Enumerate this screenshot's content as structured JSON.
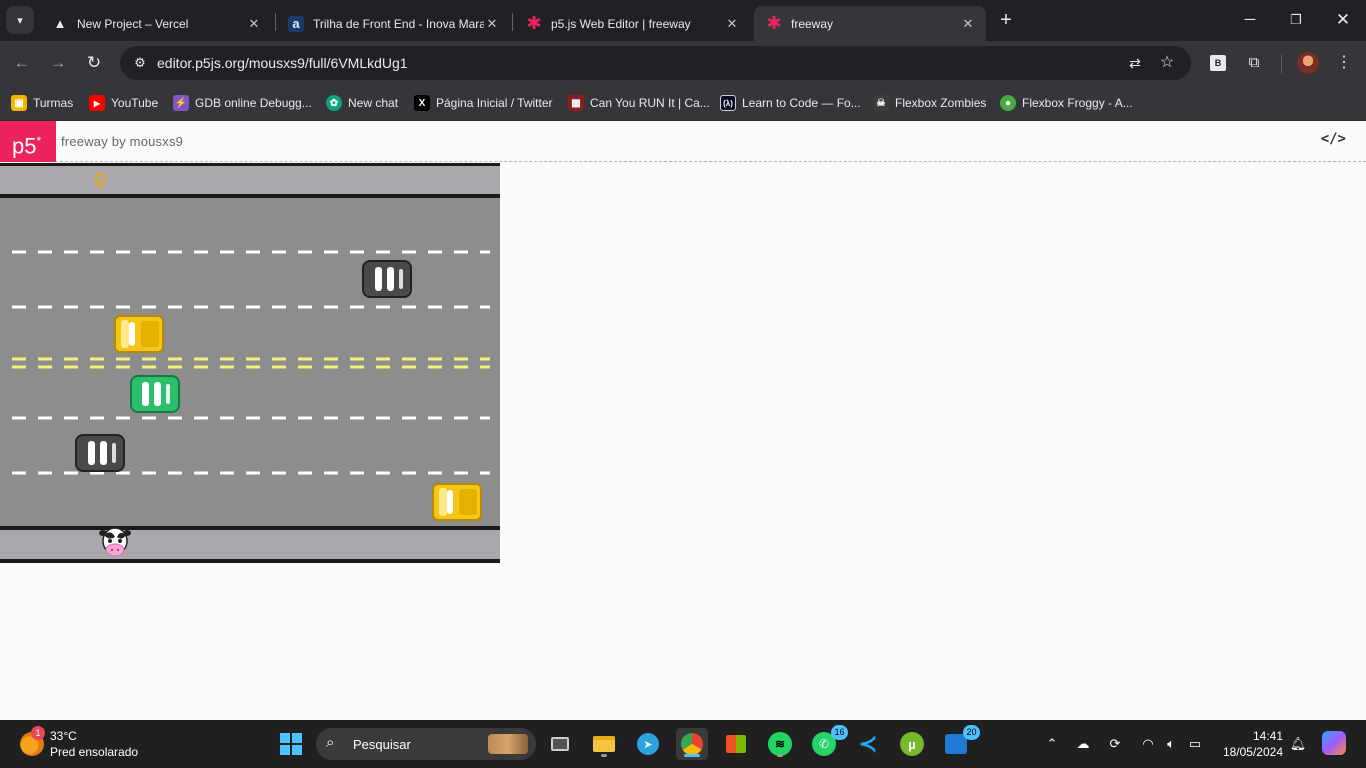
{
  "browser": {
    "tabs": [
      {
        "title": "New Project – Vercel",
        "icon": "vercel-icon"
      },
      {
        "title": "Trilha de Front End - Inova Maranhão",
        "icon": "inova-icon"
      },
      {
        "title": "p5.js Web Editor | freeway",
        "icon": "p5-asterisk-icon"
      },
      {
        "title": "freeway",
        "icon": "p5-asterisk-icon",
        "active": true
      }
    ],
    "url": "editor.p5js.org/mousxs9/full/6VMLkdUg1",
    "extension_label": "B",
    "bookmarks": [
      {
        "label": "Turmas",
        "icon": "classroom-icon",
        "color": "#f4b400"
      },
      {
        "label": "YouTube",
        "icon": "youtube-icon",
        "color": "#ff0000"
      },
      {
        "label": "GDB online Debugg...",
        "icon": "gdb-icon",
        "color": "#7e57c2"
      },
      {
        "label": "New chat",
        "icon": "chatgpt-icon",
        "color": "#10a37f"
      },
      {
        "label": "Página Inicial / Twitter",
        "icon": "x-icon",
        "color": "#000000"
      },
      {
        "label": "Can You RUN It | Ca...",
        "icon": "canyourunit-icon",
        "color": "#8b1e1e"
      },
      {
        "label": "Learn to Code — Fo...",
        "icon": "freecodecamp-icon",
        "color": "#0a0a23"
      },
      {
        "label": "Flexbox Zombies",
        "icon": "zombie-icon",
        "color": "#3c3c3c"
      },
      {
        "label": "Flexbox Froggy - A...",
        "icon": "frog-icon",
        "color": "#49a942"
      }
    ]
  },
  "p5": {
    "logo_text": "p5",
    "logo_sup": "*",
    "sketch_title": "freeway by mousxs9",
    "code_toggle": "</>"
  },
  "game": {
    "score": "0",
    "colors": {
      "sidewalk": "#a9a7ab",
      "road": "#8d8d8d",
      "yellow_line": "#f5f07c",
      "score": "#f0a500"
    },
    "cars": [
      {
        "color": "dark",
        "lane": 1
      },
      {
        "color": "yellow",
        "lane": 2
      },
      {
        "color": "green",
        "lane": 3
      },
      {
        "color": "dark",
        "lane": 4
      },
      {
        "color": "yellow",
        "lane": 5
      }
    ],
    "player": "cow"
  },
  "taskbar": {
    "weather_temp": "33°C",
    "weather_desc": "Pred ensolarado",
    "weather_badge": "1",
    "search_placeholder": "Pesquisar",
    "whatsapp_badge": "16",
    "store_badge": "20",
    "time": "14:41",
    "date": "18/05/2024"
  }
}
